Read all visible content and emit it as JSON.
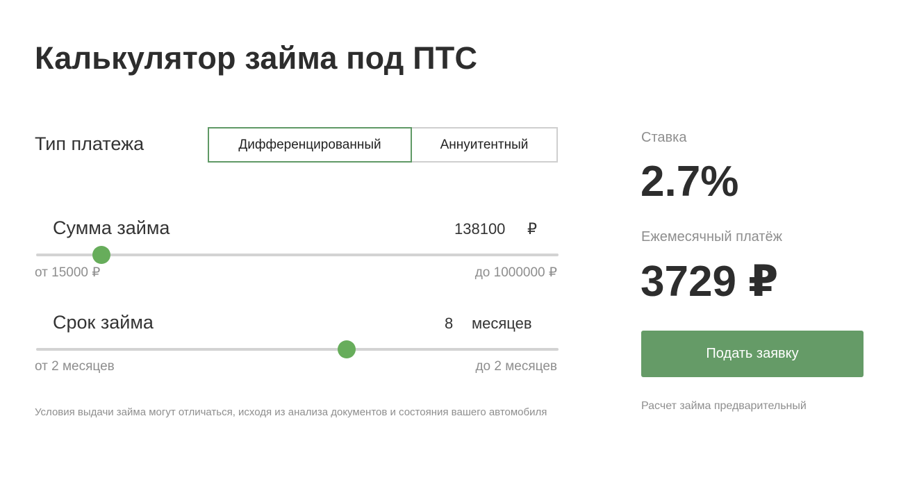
{
  "title": "Калькулятор займа под ПТС",
  "payment_type": {
    "label": "Тип платежа",
    "options": [
      "Дифференцированный",
      "Аннуитентный"
    ],
    "selected": "Дифференцированный"
  },
  "loan_amount": {
    "label": "Сумма займа",
    "value": "138100",
    "unit": "₽",
    "min_note": "от 15000 ₽",
    "max_note": "до 1000000 ₽",
    "min": 15000,
    "max": 1000000,
    "current": 138100
  },
  "loan_term": {
    "label": "Срок займа",
    "value": "8",
    "unit": "месяцев",
    "min_note": "от 2 месяцев",
    "max_note": "до 2 месяцев",
    "slider_fraction": 0.595
  },
  "disclaimer": "Условия выдачи займа могут отличаться, исходя из анализа документов и состояния вашего автомобиля",
  "summary": {
    "rate_caption": "Ставка",
    "rate_value": "2.7%",
    "monthly_caption": "Ежемесячный платёж",
    "monthly_value": "3729 ₽",
    "apply_label": "Подать заявку",
    "note": "Расчет займа предварительный"
  },
  "colors": {
    "accent": "#659b67",
    "thumb": "#67ad5b",
    "selected_border": "#5f9965",
    "muted_text": "#8e8e8e"
  }
}
